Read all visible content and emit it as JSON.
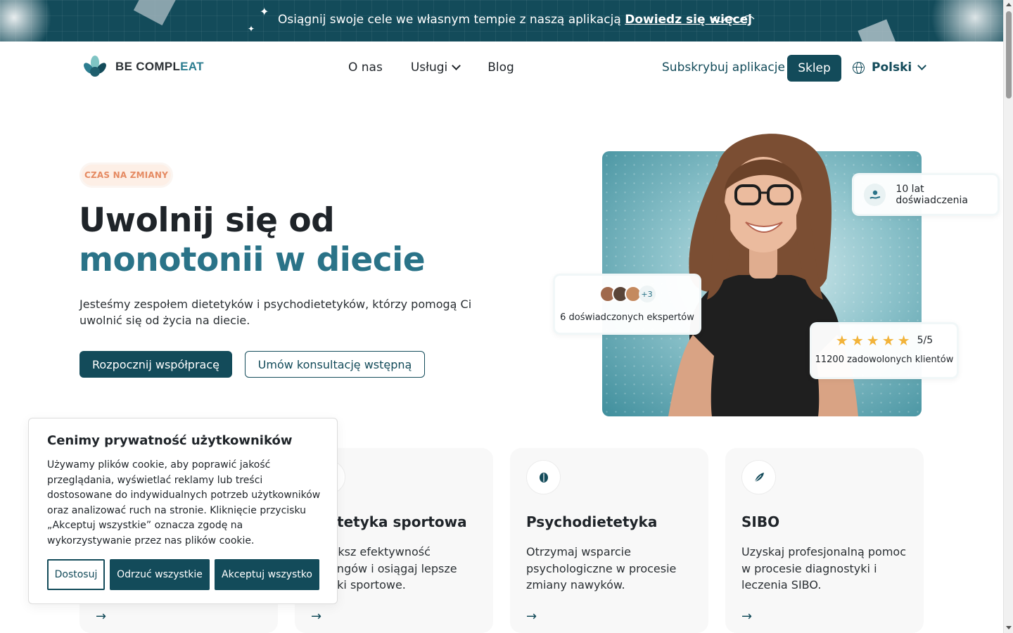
{
  "announcement": {
    "text": "Osiągnij swoje cele we własnym tempie z naszą aplikacją",
    "link": "Dowiedz się więcej"
  },
  "nav": {
    "brand": "BE COMPL",
    "brand_accent": "EAT",
    "links": [
      "O nas",
      "Usługi",
      "Blog"
    ],
    "subscribe": "Subskrybuj aplikacje",
    "shop": "Sklep",
    "language": "Polski"
  },
  "hero": {
    "badge": "CZAS NA ZMIANY",
    "title_line1": "Uwolnij się od",
    "title_line2": "monotonii w diecie",
    "lead": "Jesteśmy zespołem dietetyków i psychodietetyków, którzy pomogą Ci uwolnić się od życia na diecie.",
    "cta_primary": "Rozpocznij współpracę",
    "cta_secondary": "Umów konsultację wstępną",
    "stat_experience": "10 lat doświadczenia",
    "experts_more": "+3",
    "stat_experts": "6 doświadczonych ekspertów",
    "rating": "5/5",
    "stat_clients": "11200 zadowolonych klientów"
  },
  "services": [
    {
      "title": "",
      "desc": ""
    },
    {
      "title": "Dietetyka sportowa",
      "desc": "Zwiększ efektywność treningów i osiągaj lepsze wyniki sportowe."
    },
    {
      "title": "Psychodietetyka",
      "desc": "Otrzymaj wsparcie psychologiczne w procesie zmiany nawyków."
    },
    {
      "title": "SIBO",
      "desc": "Uzyskaj profesjonalną pomoc w procesie diagnostyki i leczenia SIBO."
    }
  ],
  "cookie": {
    "title": "Cenimy prywatność użytkowników",
    "body": "Używamy plików cookie, aby poprawić jakość przeglądania, wyświetlać reklamy lub treści dostosowane do indywidualnych potrzeb użytkowników oraz analizować ruch na stronie. Kliknięcie przycisku „Akceptuj wszystkie” oznacza zgodę na wykorzystywanie przez nas plików cookie.",
    "customize": "Dostosuj",
    "reject": "Odrzuć wszystkie",
    "accept": "Akceptuj wszystko"
  },
  "colors": {
    "primary": "#134b5a",
    "accent": "#2a7388",
    "badge_text": "#e58a62",
    "star": "#f2b33a"
  }
}
